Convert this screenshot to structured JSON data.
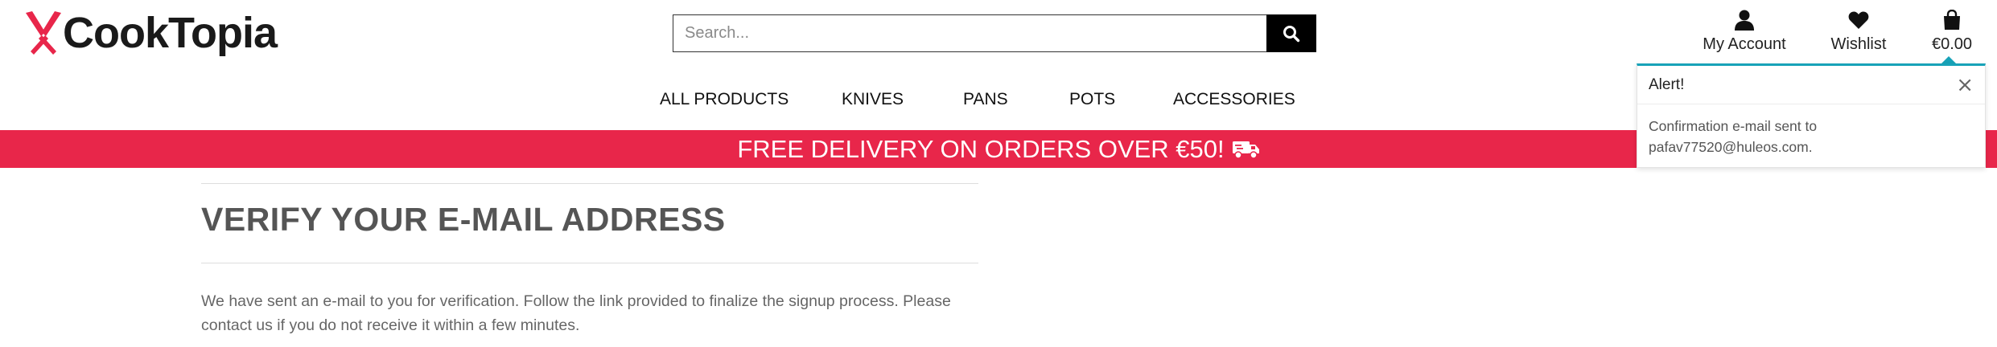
{
  "brand": {
    "name": "CookTopia",
    "accent": "#e8264a",
    "icon": "crossed-knives-logo"
  },
  "search": {
    "placeholder": "Search...",
    "value": "",
    "icon": "search-icon"
  },
  "header": {
    "account_label": "My Account",
    "wishlist_label": "Wishlist",
    "bag_total": "€0.00"
  },
  "nav": {
    "items": [
      {
        "label": "ALL PRODUCTS"
      },
      {
        "label": "KNIVES"
      },
      {
        "label": "PANS"
      },
      {
        "label": "POTS"
      },
      {
        "label": "ACCESSORIES"
      }
    ]
  },
  "banner": {
    "text": "FREE DELIVERY ON ORDERS OVER €50!",
    "icon": "truck-icon"
  },
  "main": {
    "title": "VERIFY YOUR E-MAIL ADDRESS",
    "text": "We have sent an e-mail to you for verification. Follow the link provided to finalize the signup process. Please contact us if you do not receive it within a few minutes."
  },
  "toast": {
    "title": "Alert!",
    "close_symbol": "×",
    "message_line1": "Confirmation e-mail sent to",
    "message_line2": "pafav77520@huleos.com.",
    "accent": "#17a2b8"
  }
}
